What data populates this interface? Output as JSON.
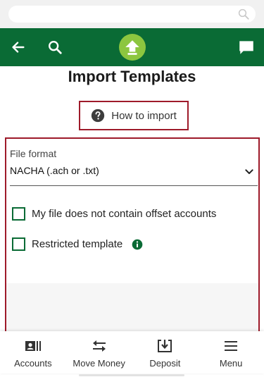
{
  "header": {
    "back_icon": "arrow-left-icon",
    "search_icon": "search-icon",
    "logo_icon": "upload-arrow-icon",
    "chat_icon": "chat-bubble-icon",
    "brand_color": "#0a6b35",
    "logo_color": "#8cc63f"
  },
  "page": {
    "title": "Import Templates"
  },
  "how_to_import": {
    "label": "How to import",
    "icon": "help-circle-icon"
  },
  "form": {
    "file_format_label": "File format",
    "file_format_value": "NACHA (.ach or .txt)",
    "checkboxes": [
      {
        "label": "My file does not contain offset accounts",
        "checked": false
      },
      {
        "label": "Restricted template",
        "checked": false
      }
    ],
    "highlight_color": "#9e1a2a"
  },
  "bottom_nav": {
    "items": [
      {
        "label": "Accounts",
        "icon": "accounts-icon"
      },
      {
        "label": "Move Money",
        "icon": "transfer-arrows-icon"
      },
      {
        "label": "Deposit",
        "icon": "deposit-icon"
      },
      {
        "label": "Menu",
        "icon": "hamburger-menu-icon"
      }
    ]
  }
}
